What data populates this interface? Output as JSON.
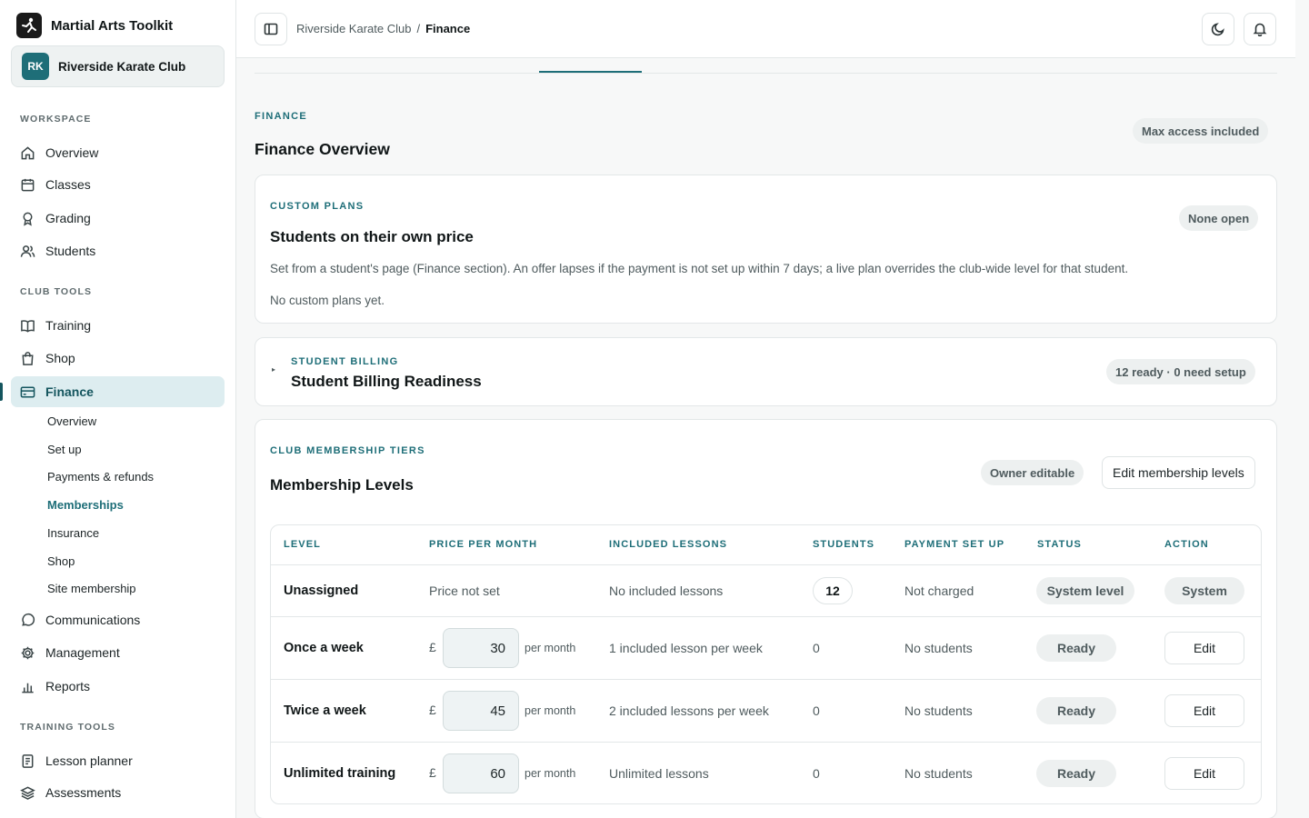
{
  "app": {
    "title": "Martial Arts Toolkit"
  },
  "club": {
    "initials": "RK",
    "name": "Riverside Karate Club"
  },
  "sidebar": {
    "sections": {
      "workspace": "WORKSPACE",
      "club_tools": "CLUB TOOLS",
      "training_tools": "TRAINING TOOLS"
    },
    "items": {
      "overview": "Overview",
      "classes": "Classes",
      "grading": "Grading",
      "students": "Students",
      "training": "Training",
      "shop": "Shop",
      "finance": "Finance",
      "communications": "Communications",
      "management": "Management",
      "reports": "Reports",
      "lesson_planner": "Lesson planner",
      "assessments": "Assessments"
    },
    "finance_sub": [
      "Overview",
      "Set up",
      "Payments & refunds",
      "Memberships",
      "Insurance",
      "Shop",
      "Site membership"
    ]
  },
  "topbar": {
    "breadcrumb_club": "Riverside Karate Club",
    "breadcrumb_sep": "/",
    "breadcrumb_current": "Finance"
  },
  "page": {
    "eyebrow": "FINANCE",
    "title": "Finance Overview",
    "access_badge": "Max access included"
  },
  "custom_plans": {
    "eyebrow": "CUSTOM PLANS",
    "title": "Students on their own price",
    "badge": "None open",
    "description": "Set from a student's page (Finance section). An offer lapses if the payment is not set up within 7 days; a live plan overrides the club-wide level for that student.",
    "empty": "No custom plans yet."
  },
  "billing": {
    "eyebrow": "STUDENT BILLING",
    "title": "Student Billing Readiness",
    "badge": "12 ready · 0 need setup",
    "toggle": "▸"
  },
  "tiers": {
    "eyebrow": "CLUB MEMBERSHIP TIERS",
    "title": "Membership Levels",
    "owner_badge": "Owner editable",
    "edit_button": "Edit membership levels",
    "columns": [
      "LEVEL",
      "PRICE PER MONTH",
      "INCLUDED LESSONS",
      "STUDENTS",
      "PAYMENT SET UP",
      "STATUS",
      "ACTION"
    ],
    "rows": [
      {
        "level": "Unassigned",
        "price_text": "Price not set",
        "lessons": "No included lessons",
        "students": "12",
        "payment": "Not charged",
        "status": "System level",
        "action": "System"
      },
      {
        "level": "Once a week",
        "currency": "£",
        "price": "30",
        "per": "per month",
        "lessons": "1 included lesson per week",
        "students": "0",
        "payment": "No students",
        "status": "Ready",
        "action": "Edit"
      },
      {
        "level": "Twice a week",
        "currency": "£",
        "price": "45",
        "per": "per month",
        "lessons": "2 included lessons per week",
        "students": "0",
        "payment": "No students",
        "status": "Ready",
        "action": "Edit"
      },
      {
        "level": "Unlimited training",
        "currency": "£",
        "price": "60",
        "per": "per month",
        "lessons": "Unlimited lessons",
        "students": "0",
        "payment": "No students",
        "status": "Ready",
        "action": "Edit"
      }
    ]
  }
}
